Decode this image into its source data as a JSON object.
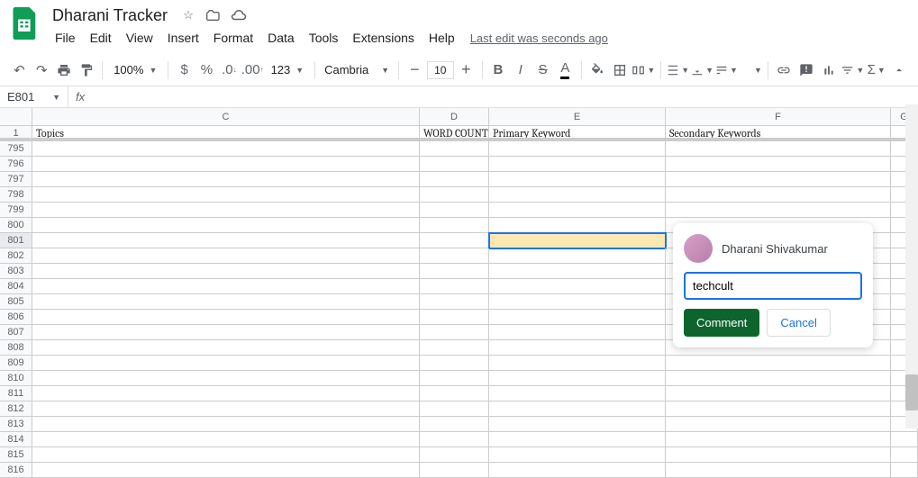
{
  "header": {
    "doc_title": "Dharani Tracker",
    "menus": [
      "File",
      "Edit",
      "View",
      "Insert",
      "Format",
      "Data",
      "Tools",
      "Extensions",
      "Help"
    ],
    "last_edit": "Last edit was seconds ago"
  },
  "toolbar": {
    "zoom": "100%",
    "font": "Cambria",
    "font_size": "10",
    "num_fmt": "123"
  },
  "formula_bar": {
    "cell_ref": "E801",
    "fx_label": "fx",
    "value": ""
  },
  "columns": [
    {
      "id": "C",
      "label": "C",
      "w": "c-C"
    },
    {
      "id": "D",
      "label": "D",
      "w": "c-D"
    },
    {
      "id": "E",
      "label": "E",
      "w": "c-E"
    },
    {
      "id": "F",
      "label": "F",
      "w": "c-F"
    },
    {
      "id": "G",
      "label": "G",
      "w": "c-G"
    }
  ],
  "frozen_row": {
    "num": "1",
    "cells": {
      "C": "Topics",
      "D": "WORD COUNT",
      "E": "Primary Keyword",
      "F": "Secondary Keywords",
      "G": ""
    }
  },
  "row_start": 795,
  "row_end": 816,
  "active_row": 801,
  "active_col": "E",
  "comment": {
    "user": "Dharani Shivakumar",
    "input_value": "techcult",
    "btn_comment": "Comment",
    "btn_cancel": "Cancel"
  }
}
